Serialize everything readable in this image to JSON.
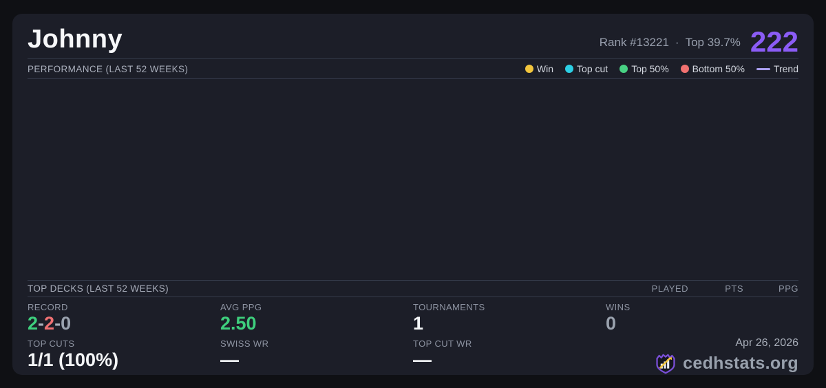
{
  "card": {
    "title": "Johnny",
    "rank_text": "Rank #13221",
    "separator": "·",
    "top_percent": "Top 39.7%",
    "score": "222",
    "score_color": "#8b5cf6"
  },
  "performance": {
    "header": "PERFORMANCE (LAST 52 WEEKS)",
    "legend": [
      {
        "label": "Win",
        "color": "#f2c53d",
        "swatch": "dot"
      },
      {
        "label": "Top cut",
        "color": "#2ccfe4",
        "swatch": "dot"
      },
      {
        "label": "Top 50%",
        "color": "#48d183",
        "swatch": "dot"
      },
      {
        "label": "Bottom 50%",
        "color": "#f17170",
        "swatch": "dot"
      },
      {
        "label": "Trend",
        "color": "#aa9ff0",
        "swatch": "line"
      }
    ]
  },
  "chart_data": {
    "type": "scatter",
    "title": "PERFORMANCE (LAST 52 WEEKS)",
    "xlabel": "last 52 weeks",
    "ylabel": "",
    "grid": false,
    "legend_position": "top-right",
    "series": [
      {
        "name": "Win",
        "points": []
      },
      {
        "name": "Top cut",
        "points": []
      },
      {
        "name": "Top 50%",
        "points": []
      },
      {
        "name": "Bottom 50%",
        "points": []
      },
      {
        "name": "Trend",
        "points": []
      }
    ],
    "note": "plot area rendered empty - no tournament results plotted"
  },
  "top_decks": {
    "header": "TOP DECKS (LAST 52 WEEKS)",
    "columns": [
      "PLAYED",
      "PTS",
      "PPG"
    ],
    "rows": []
  },
  "stats": {
    "cells": [
      {
        "label": "RECORD",
        "parts": [
          [
            "2",
            "#3ecf7d"
          ],
          [
            "-",
            "#aab0bb"
          ],
          [
            "2",
            "#ef7173"
          ],
          [
            "-",
            "#aab0bb"
          ],
          [
            "0",
            "#9aa2ae"
          ]
        ]
      },
      {
        "label": "AVG PPG",
        "parts": [
          [
            "2.50",
            "#3ecf7d"
          ]
        ]
      },
      {
        "label": "TOURNAMENTS",
        "parts": [
          [
            "1",
            "#f4f6f8"
          ]
        ]
      },
      {
        "label": "WINS",
        "parts": [
          [
            "0",
            "#9aa2ae"
          ]
        ]
      },
      {
        "label": "TOP CUTS",
        "parts": [
          [
            "1/1 (100%)",
            "#f4f6f8"
          ]
        ]
      },
      {
        "label": "SWISS WR",
        "parts": [
          [
            "—",
            "#f4f6f8"
          ]
        ]
      },
      {
        "label": "TOP CUT WR",
        "parts": [
          [
            "—",
            "#f4f6f8"
          ]
        ]
      }
    ]
  },
  "footer": {
    "date": "Apr 26, 2026",
    "brand": "cedhstats.org",
    "brand_icon": "shield-bar-chart-arrow-icon"
  },
  "colors": {
    "background": "#0f1014",
    "card": "#1c1e28",
    "divider": "#353b4b",
    "accent_purple": "#8b5cf6",
    "gold": "#f2c53d"
  }
}
